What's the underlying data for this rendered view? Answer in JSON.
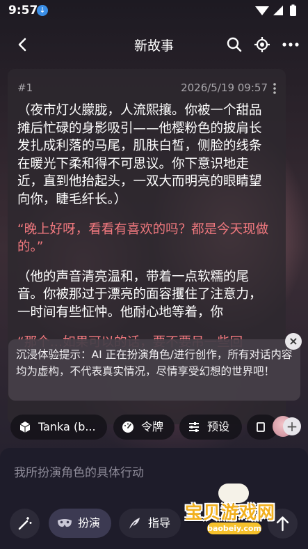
{
  "status_bar": {
    "time": "9:57"
  },
  "header": {
    "title": "新故事"
  },
  "message": {
    "index": "#1",
    "timestamp": "2026/5/19 09:57",
    "paragraphs": [
      "（夜市灯火朦胧，人流熙攘。你被一个甜品摊后忙碌的身影吸引——他樱粉色的披肩长发扎成利落的马尾，肌肤白皙，侧脸的线条在暖光下柔和得不可思议。你下意识地走近，直到他抬起头，一双大而明亮的眼睛望向你，睫毛纤长。）",
      "“晚上好呀，看看有喜欢的吗？都是今天现做的。”",
      "（他的声音清亮温和，带着一点软糯的尾音。你被那过于漂亮的面容攫住了注意力，一时间有些怔忡。他耐心地等着，你",
      "“那个…如果可以的话，要不要吊一些回"
    ]
  },
  "notice": {
    "text": "沉浸体验提示：AI 正在扮演角色/进行创作，所有对话内容均为虚构，不代表真实情况，尽情享受幻想的世界吧！"
  },
  "chips": [
    {
      "label": "Tanka (b..."
    },
    {
      "label": "令牌"
    },
    {
      "label": "预设"
    }
  ],
  "composer": {
    "placeholder": "我所扮演角色的具体行动",
    "modes": [
      {
        "label": "扮演"
      },
      {
        "label": "指导"
      }
    ]
  },
  "watermark": {
    "cn": "宝贝游戏网",
    "en": "baobeiy.com"
  },
  "colors": {
    "accent_pink": "#f0787e",
    "card_bg": "#2d282e",
    "panel_bg": "#1e1c2a",
    "download_badge": "#3a8ee6"
  }
}
